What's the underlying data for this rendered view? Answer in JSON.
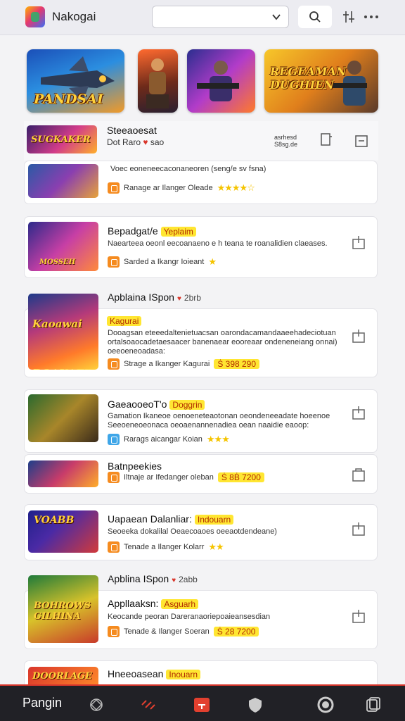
{
  "header": {
    "app_name": "Nakogai",
    "select_value": "",
    "icons": [
      "app-logo-icon",
      "chevron-down-icon",
      "search-icon",
      "filter-icon",
      "more-icon"
    ]
  },
  "banners": [
    {
      "text": "PANDSAI"
    },
    {
      "text": ""
    },
    {
      "text": ""
    },
    {
      "text": "REGEAMAN DUGHIEN"
    }
  ],
  "sticky": {
    "thumb_text": "SUGKAKER",
    "title": "Steeaoesat",
    "subtitle": "Dot Raro",
    "subtitle_tail": "sao",
    "action_text": "asrhesd S8sg.de"
  },
  "items": [
    {
      "thumb_text": "",
      "desc": "Voec eoneneecaconaneoren (seng/e sv fsna)",
      "meta": "Ranage ar Ilanger Oleade",
      "stars": "★★★★☆",
      "icon_color": "orange"
    },
    {
      "thumb_text": "MOSSEH",
      "title": "Bepadgat/e",
      "tag": "Yeplaim",
      "desc": "Naearteea oeonl eecoanaeno e h teana te roanalidien claeases.",
      "meta": "Sarded a Ikangr Ioieant",
      "stars": "★",
      "icon_color": "orange"
    },
    {
      "section": "Apblaina ISpon",
      "section_sub": "2brb",
      "thumb_text": "Kaoawai DOAKAER",
      "title": "",
      "tag": "Kagurai",
      "desc_lines": [
        "Dooagsan eteeedaltenietuacsan oarondacamandaaeehadeciotuan",
        "ortalsoaocadetaesaacer banenaear eooreaar ondeneneiang onnai)",
        "oeeoeneoadasa:"
      ],
      "meta": "Strage a Ikanger Kagurai",
      "price": "Ṡ 398 290",
      "icon_color": "orange"
    },
    {
      "thumb_text": "",
      "title": "GaeaooeoT'o",
      "tag": "Doggrin",
      "desc_lines": [
        "Gamation Ikaneoe oenoeneteaotonan oeondeneeadate hoeenoe",
        "Seeoeneoeonaca oeoaenannenadiea oean naaidie eaoop:"
      ],
      "meta": "Rarags aicangar Koian",
      "stars": "★★★",
      "icon_color": "blue"
    },
    {
      "thumb_text": "",
      "title": "Batnpeekies",
      "meta": "Iltnaje ar Ifedanger oleban",
      "price": "Ṡ 8Ḃ 7200",
      "icon_color": "orange"
    },
    {
      "thumb_text": "VOABB",
      "title": "Uapaean Dalanliar:",
      "tag": "Indouarn",
      "desc": "Seoeeka dokalilal Oeaecoaoes oeeaotdendeane)",
      "meta": "Tenade a Ilanger Kolarr",
      "stars": "★★",
      "icon_color": "orange"
    },
    {
      "section": "Apblina ISpon",
      "section_sub": "2abb",
      "thumb_text": "BOHROWS GILHINA",
      "title": "Appllaaksn:",
      "tag": "Asguarh",
      "desc": "Keocande peoran Dareranaoriepoaieansesdian",
      "meta": "Tenade & Ilanger Soeran",
      "price": "Ṡ 28 7200",
      "icon_color": "orange"
    },
    {
      "thumb_text": "DOORLAGE",
      "title": "Hneeoasean",
      "tag": "Inouarn"
    }
  ],
  "bottom_bar": {
    "label": "Pangin",
    "icons": [
      "compass-icon",
      "link-icon",
      "home-icon",
      "shield-icon",
      "record-icon",
      "copy-icon"
    ]
  }
}
